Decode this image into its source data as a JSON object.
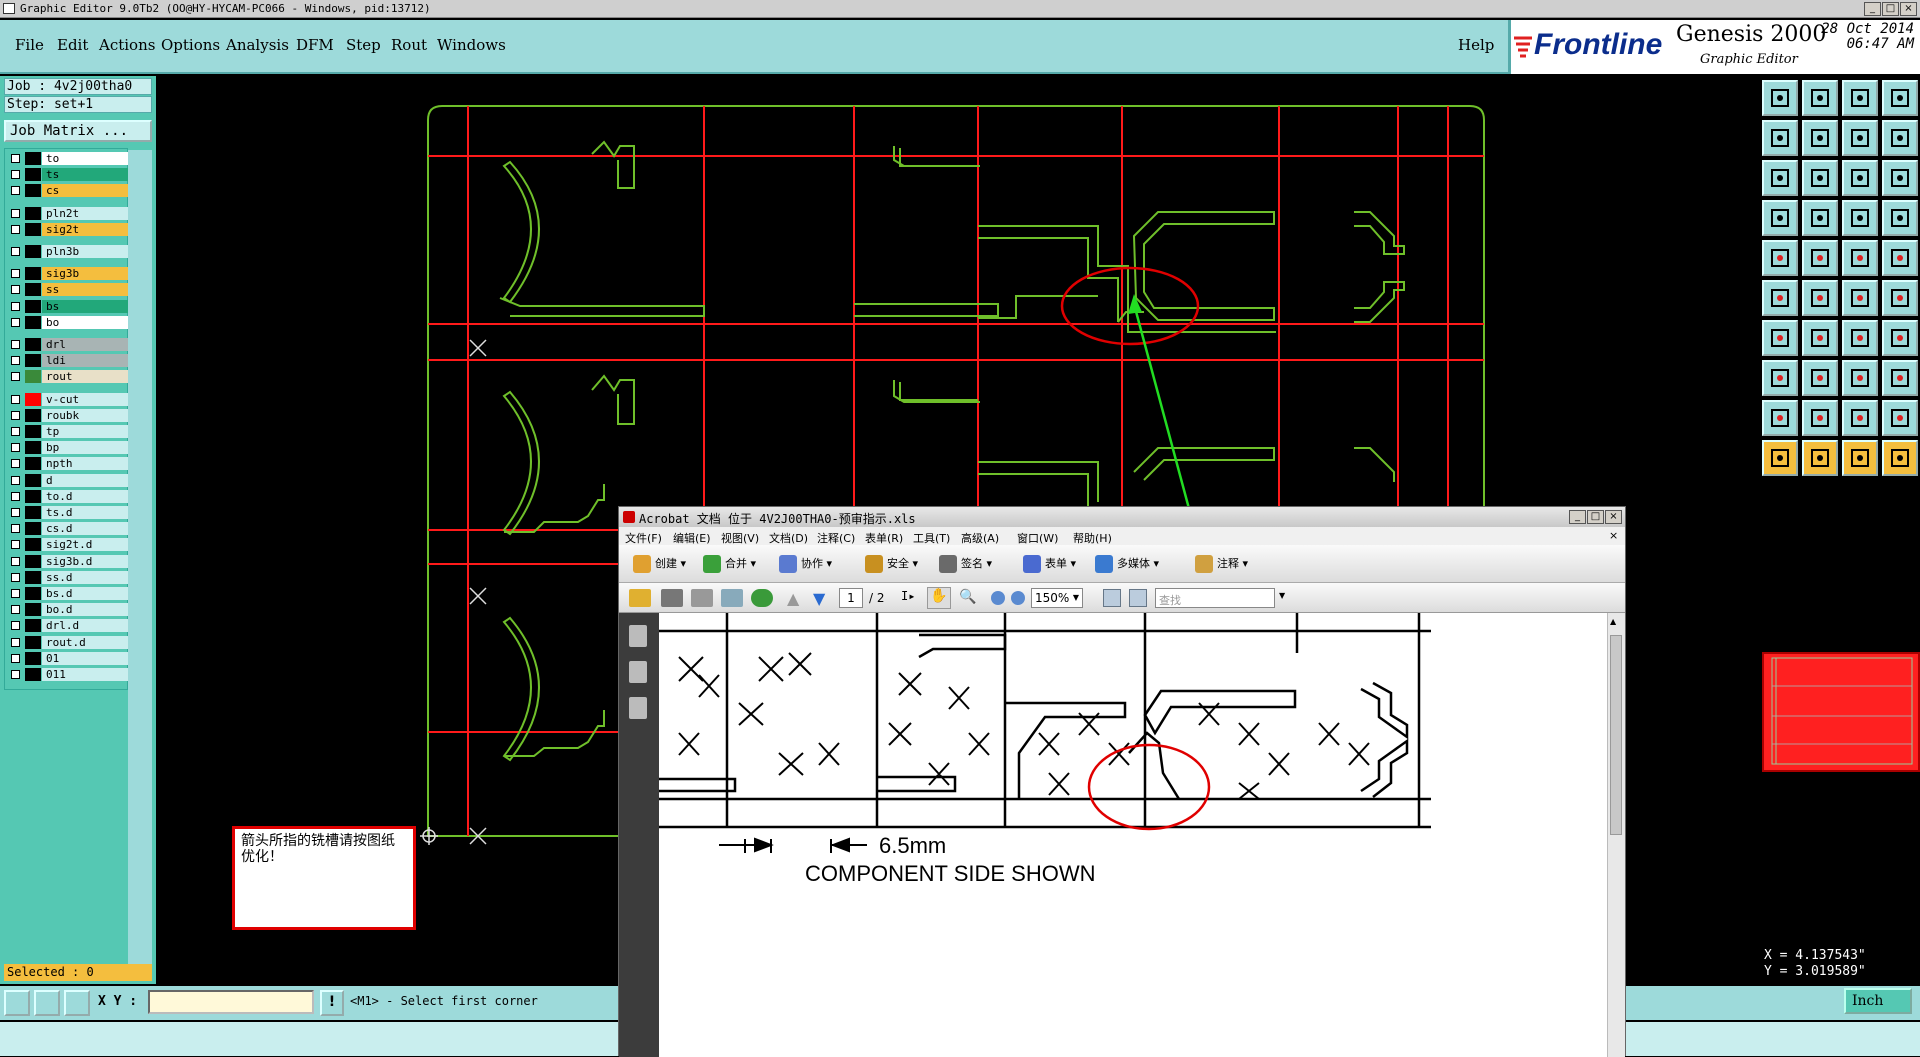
{
  "window": {
    "title": "Graphic Editor 9.0Tb2 (OO@HY-HYCAM-PC066 - Windows, pid:13712)",
    "controls": [
      "_",
      "□",
      "×"
    ]
  },
  "menu": [
    "File",
    "Edit",
    "Actions",
    "Options",
    "Analysis",
    "DFM",
    "Step",
    "Rout",
    "Windows"
  ],
  "help": "Help",
  "brand": {
    "logo": "Frontline",
    "product": "Genesis 2000",
    "subtitle": "Graphic Editor",
    "date": "28 Oct 2014",
    "time": "06:47 AM"
  },
  "job": {
    "job_label": "Job : 4v2j00tha0",
    "step_label": "Step: set+1",
    "matrix_button": "Job Matrix ..."
  },
  "layers": [
    {
      "name": "to",
      "bg": "#ffffff",
      "sw": "#000000"
    },
    {
      "name": "ts",
      "bg": "#22a87a",
      "sw": "#000000"
    },
    {
      "name": "cs",
      "bg": "#f4be3e",
      "sw": "#000000"
    },
    {
      "name": "pln2t",
      "bg": "#c9eeee",
      "sw": "#000000"
    },
    {
      "name": "sig2t",
      "bg": "#f4be3e",
      "sw": "#000000"
    },
    {
      "name": "pln3b",
      "bg": "#c9eeee",
      "sw": "#000000"
    },
    {
      "name": "sig3b",
      "bg": "#f4be3e",
      "sw": "#000000"
    },
    {
      "name": "ss",
      "bg": "#f4be3e",
      "sw": "#000000"
    },
    {
      "name": "bs",
      "bg": "#22a87a",
      "sw": "#000000"
    },
    {
      "name": "bo",
      "bg": "#ffffff",
      "sw": "#000000"
    },
    {
      "name": "drl",
      "bg": "#a8b4b4",
      "sw": "#000000"
    },
    {
      "name": "ldi",
      "bg": "#a8b4b4",
      "sw": "#000000"
    },
    {
      "name": "rout",
      "bg": "#e8e0c8",
      "sw": "#3a8a3a"
    },
    {
      "name": "v-cut",
      "bg": "#c9eeee",
      "sw": "#ff0000"
    },
    {
      "name": "roubk",
      "bg": "#c9eeee",
      "sw": "#000000"
    },
    {
      "name": "tp",
      "bg": "#c9eeee",
      "sw": "#000000"
    },
    {
      "name": "bp",
      "bg": "#c9eeee",
      "sw": "#000000"
    },
    {
      "name": "npth",
      "bg": "#c9eeee",
      "sw": "#000000"
    },
    {
      "name": "d",
      "bg": "#c9eeee",
      "sw": "#000000"
    },
    {
      "name": "to.d",
      "bg": "#c9eeee",
      "sw": "#000000"
    },
    {
      "name": "ts.d",
      "bg": "#c9eeee",
      "sw": "#000000"
    },
    {
      "name": "cs.d",
      "bg": "#c9eeee",
      "sw": "#000000"
    },
    {
      "name": "sig2t.d",
      "bg": "#c9eeee",
      "sw": "#000000"
    },
    {
      "name": "sig3b.d",
      "bg": "#c9eeee",
      "sw": "#000000"
    },
    {
      "name": "ss.d",
      "bg": "#c9eeee",
      "sw": "#000000"
    },
    {
      "name": "bs.d",
      "bg": "#c9eeee",
      "sw": "#000000"
    },
    {
      "name": "bo.d",
      "bg": "#c9eeee",
      "sw": "#000000"
    },
    {
      "name": "drl.d",
      "bg": "#c9eeee",
      "sw": "#000000"
    },
    {
      "name": "rout.d",
      "bg": "#c9eeee",
      "sw": "#000000"
    },
    {
      "name": "01",
      "bg": "#c9eeee",
      "sw": "#000000"
    },
    {
      "name": "011",
      "bg": "#c9eeee",
      "sw": "#000000"
    }
  ],
  "selected": "Selected : 0",
  "status": {
    "xy_label": "X Y :",
    "message": "<M1> - Select first corner",
    "unit": "Inch"
  },
  "coords": {
    "x": "X = 4.137543\"",
    "y": "Y = 3.019589\""
  },
  "note": "箭头所指的铣槽请按图纸优化！",
  "acrobat": {
    "title": "Acrobat 文档 位于 4V2J00THA0-预审指示.xls",
    "menu": [
      "文件(F)",
      "编辑(E)",
      "视图(V)",
      "文档(D)",
      "注释(C)",
      "表单(R)",
      "工具(T)",
      "高级(A)",
      "窗口(W)",
      "帮助(H)"
    ],
    "toolbar": [
      "创建",
      "合并",
      "协作",
      "安全",
      "签名",
      "表单",
      "多媒体",
      "注释"
    ],
    "page_current": "1",
    "page_total": "/ 2",
    "zoom": "150%",
    "search_placeholder": "查找",
    "drawing_dimension": "6.5mm",
    "drawing_caption": "COMPONENT SIDE SHOWN"
  },
  "colors": {
    "accent": "#9ddada",
    "panel": "#55c8b3",
    "rout": "#7cc02a",
    "vcut": "#ff0000",
    "arrow": "#22dd22",
    "highlight": "#e00000"
  }
}
